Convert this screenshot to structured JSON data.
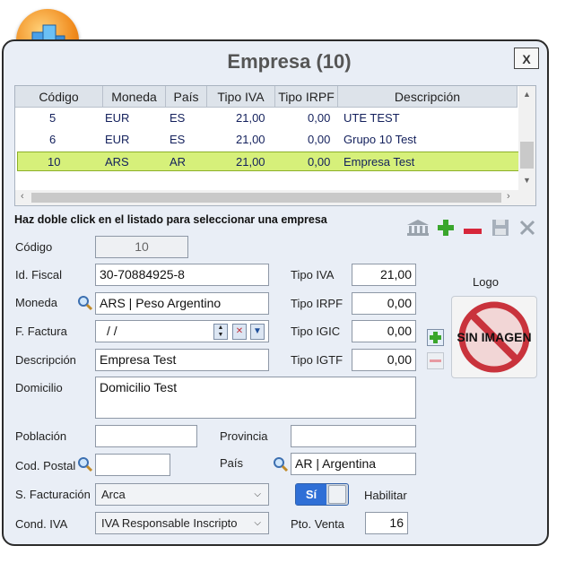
{
  "window": {
    "title": "Empresa (10)",
    "close_label": "X"
  },
  "grid": {
    "columns": [
      "Código",
      "Moneda",
      "País",
      "Tipo IVA",
      "Tipo IRPF",
      "Descripción"
    ],
    "rows": [
      {
        "codigo": "5",
        "moneda": "EUR",
        "pais": "ES",
        "tipo_iva": "21,00",
        "tipo_irpf": "0,00",
        "descripcion": "UTE TEST"
      },
      {
        "codigo": "6",
        "moneda": "EUR",
        "pais": "ES",
        "tipo_iva": "21,00",
        "tipo_irpf": "0,00",
        "descripcion": "Grupo 10 Test"
      },
      {
        "codigo": "10",
        "moneda": "ARS",
        "pais": "AR",
        "tipo_iva": "21,00",
        "tipo_irpf": "0,00",
        "descripcion": "Empresa Test"
      }
    ],
    "selected_row": 2
  },
  "hint": "Haz doble click en el listado para seleccionar una empresa",
  "form": {
    "codigo": {
      "label": "Código",
      "value": "10"
    },
    "id_fiscal": {
      "label": "Id. Fiscal",
      "value": "30-70884925-8"
    },
    "moneda": {
      "label": "Moneda",
      "value": "ARS | Peso Argentino"
    },
    "f_factura": {
      "label": "F. Factura",
      "value": "/ /"
    },
    "descripcion": {
      "label": "Descripción",
      "value": "Empresa Test"
    },
    "domicilio": {
      "label": "Domicilio",
      "value": "Domicilio Test"
    },
    "poblacion": {
      "label": "Población",
      "value": ""
    },
    "provincia": {
      "label": "Provincia",
      "value": ""
    },
    "cod_postal": {
      "label": "Cod. Postal",
      "value": ""
    },
    "pais": {
      "label": "País",
      "value": "AR | Argentina"
    },
    "s_facturacion": {
      "label": "S. Facturación",
      "value": "Arca"
    },
    "cond_iva": {
      "label": "Cond. IVA",
      "value": "IVA Responsable Inscripto"
    },
    "tipo_iva": {
      "label": "Tipo IVA",
      "value": "21,00"
    },
    "tipo_irpf": {
      "label": "Tipo IRPF",
      "value": "0,00"
    },
    "tipo_igic": {
      "label": "Tipo IGIC",
      "value": "0,00"
    },
    "tipo_igtf": {
      "label": "Tipo IGTF",
      "value": "0,00"
    },
    "habilitar": {
      "label": "Habilitar",
      "toggle_text": "Sí",
      "on": true
    },
    "pto_venta": {
      "label": "Pto. Venta",
      "value": "16"
    }
  },
  "logo": {
    "label": "Logo",
    "placeholder_text": "SIN IMAGEN"
  },
  "toolbar": {
    "icons": [
      "bank-icon",
      "add-icon",
      "remove-icon",
      "save-icon",
      "cancel-icon"
    ]
  },
  "colors": {
    "accent": "#2f6fd6",
    "selected_row": "#d6f07a",
    "window_bg": "#e9eef6"
  }
}
